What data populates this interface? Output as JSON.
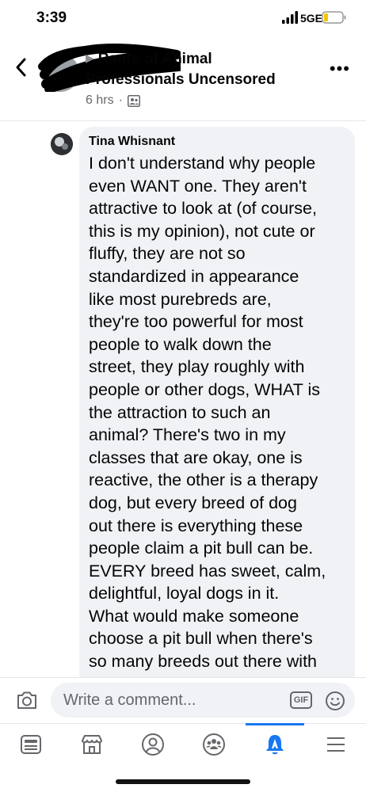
{
  "status_bar": {
    "time": "3:39",
    "network": "5GE",
    "icons": [
      "signal-bars-icon",
      "battery-low-icon"
    ]
  },
  "post": {
    "group_name_line1": "Rants of Animal",
    "group_name_line2": "Professionals Uncensored",
    "timestamp": "6 hrs",
    "separator": "·",
    "audience_icon": "group-members-icon"
  },
  "comment": {
    "author": "Tina Whisnant",
    "text": "I don't understand why people\neven WANT one.  They aren't\nattractive to look at (of course,\nthis is my opinion), not cute or\nfluffy, they are not so\nstandardized in appearance\nlike most purebreds are,\nthey're too powerful for most\npeople to walk down the\nstreet, they play roughly with\npeople or other dogs, WHAT is\nthe attraction to such an\nanimal?  There's two in my\nclasses that are okay, one is\nreactive, the other is a therapy\ndog, but every breed of dog\nout there is everything these\npeople claim a pit bull can be.\nEVERY breed has sweet, calm,\ndelightful, loyal dogs in it.\nWhat would make someone\nchoose a pit bull when there's\nso many breeds out there with"
  },
  "composer": {
    "placeholder": "Write a comment...",
    "gif_label": "GIF"
  },
  "bottom_nav": {
    "items": [
      "news-feed-icon",
      "marketplace-icon",
      "profile-icon",
      "groups-icon",
      "notifications-icon",
      "menu-icon"
    ],
    "active": "notifications-icon"
  },
  "colors": {
    "accent": "#1877f2",
    "bubble": "#f0f2f5",
    "secondary_text": "#65676b"
  }
}
